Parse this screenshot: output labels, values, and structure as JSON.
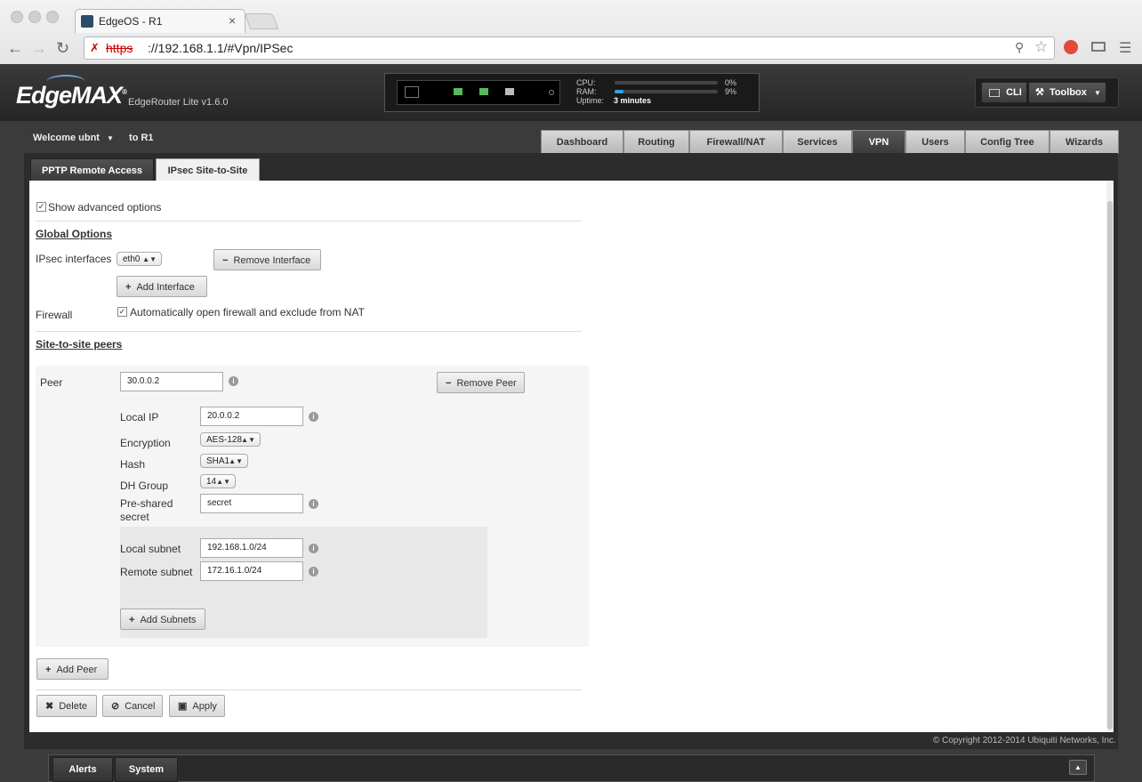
{
  "browser": {
    "tab_title": "EdgeOS - R1",
    "tab_close": "×",
    "url_scheme": "https",
    "url_rest": "://192.168.1.1/#Vpn/IPSec"
  },
  "header": {
    "logo": "EdgeMAX",
    "logo_mark": "®",
    "model": "EdgeRouter Lite v1.6.0",
    "cpu_label": "CPU:",
    "cpu_value": "0%",
    "cpu_fraction": 0.0,
    "ram_label": "RAM:",
    "ram_value": "9%",
    "ram_fraction": 0.09,
    "uptime_label": "Uptime:",
    "uptime_value": "3 minutes",
    "cli_label": "CLI",
    "toolbox_label": "Toolbox"
  },
  "nav": {
    "welcome": "Welcome ubnt",
    "to": "to R1",
    "tabs": [
      "Dashboard",
      "Routing",
      "Firewall/NAT",
      "Services",
      "VPN",
      "Users",
      "Config Tree",
      "Wizards"
    ],
    "active": "VPN"
  },
  "subtabs": [
    "PPTP Remote Access",
    "IPsec Site-to-Site"
  ],
  "form": {
    "show_advanced": "Show advanced options",
    "global_options": "Global Options",
    "ipsec_interfaces_label": "IPsec interfaces",
    "ipsec_interface_value": "eth0",
    "remove_interface": "Remove Interface",
    "add_interface": "Add Interface",
    "firewall_label": "Firewall",
    "firewall_option": "Automatically open firewall and exclude from NAT",
    "peers_title": "Site-to-site peers",
    "peer_label": "Peer",
    "peer_value": "30.0.0.2",
    "remove_peer": "Remove Peer",
    "local_ip_label": "Local IP",
    "local_ip_value": "20.0.0.2",
    "encryption_label": "Encryption",
    "encryption_value": "AES-128",
    "hash_label": "Hash",
    "hash_value": "SHA1",
    "dh_label": "DH Group",
    "dh_value": "14",
    "psk_label_1": "Pre-shared",
    "psk_label_2": "secret",
    "psk_value": "secret",
    "local_subnet_label": "Local subnet",
    "local_subnet_value": "192.168.1.0/24",
    "remote_subnet_label": "Remote subnet",
    "remote_subnet_value": "172.16.1.0/24",
    "add_subnets": "Add Subnets",
    "add_peer": "Add Peer",
    "delete": "Delete",
    "cancel": "Cancel",
    "apply": "Apply"
  },
  "footer": "© Copyright 2012-2014 Ubiquiti Networks, Inc.",
  "bottom_tabs": [
    "Alerts",
    "System"
  ],
  "colors": {
    "accent": "#39a0e0",
    "port_active": "#5cb85c"
  }
}
